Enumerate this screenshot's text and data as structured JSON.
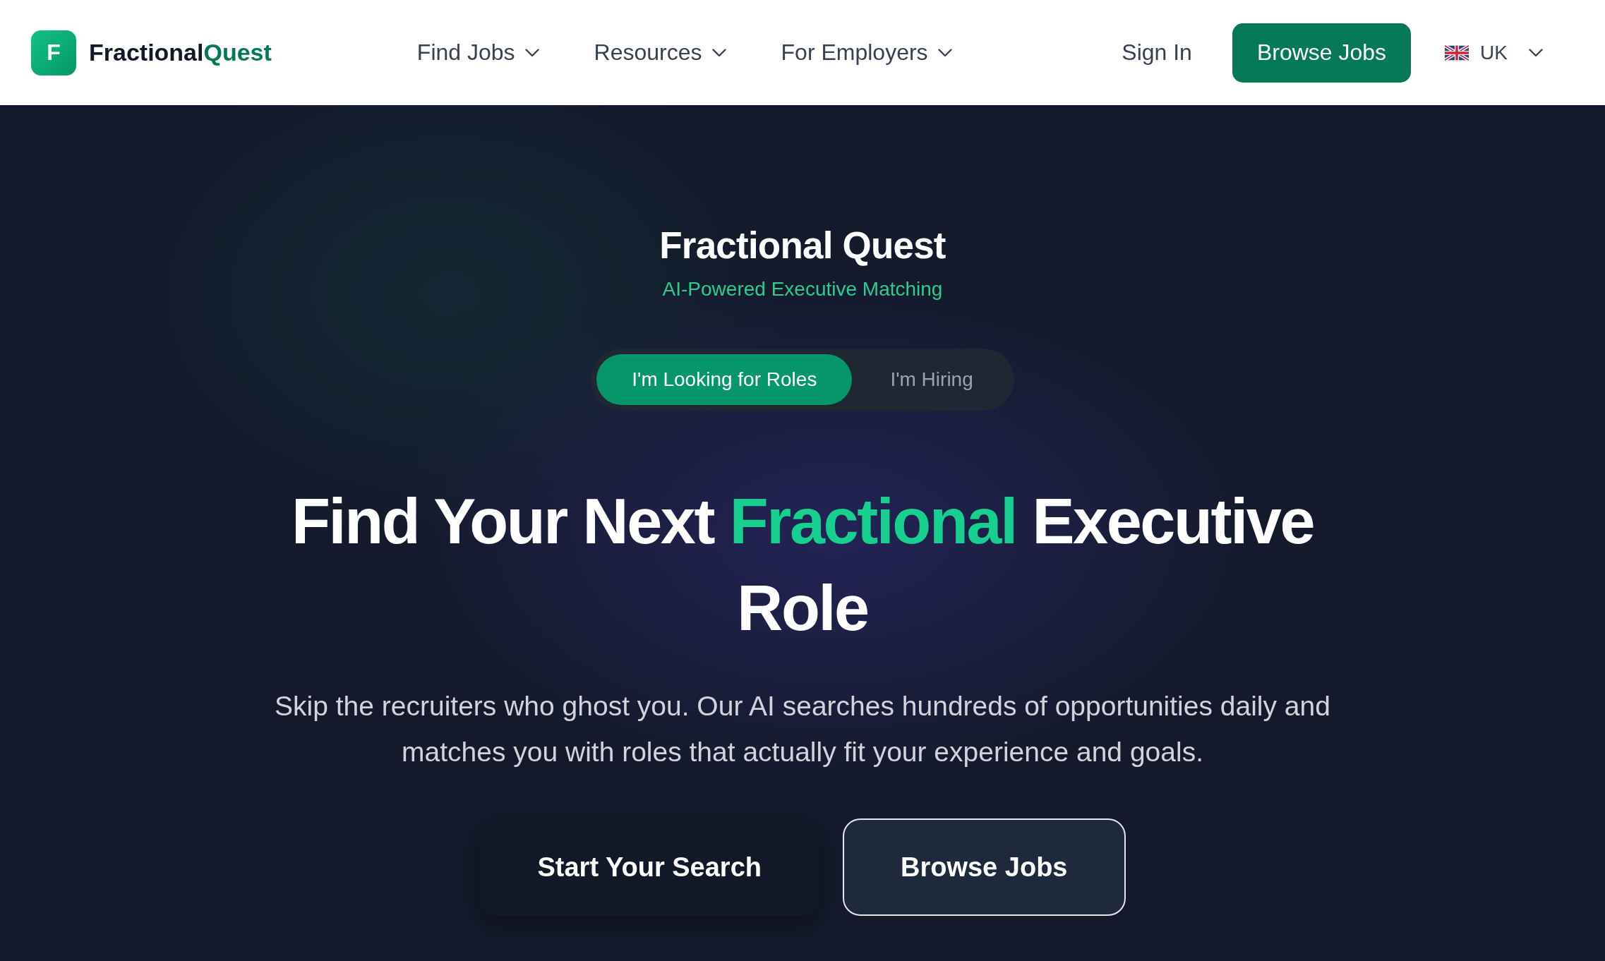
{
  "header": {
    "logo": {
      "letter": "F",
      "name": "Fractional",
      "accent": "Quest"
    },
    "nav": [
      {
        "label": "Find Jobs",
        "dropdown": true
      },
      {
        "label": "Resources",
        "dropdown": true
      },
      {
        "label": "For Employers",
        "dropdown": true
      }
    ],
    "sign_in": "Sign In",
    "cta": "Browse Jobs",
    "region": {
      "label": "UK",
      "dropdown": true
    }
  },
  "hero": {
    "title": "Fractional Quest",
    "tagline": "AI-Powered Executive Matching",
    "audience_toggle": [
      {
        "label": "I'm Looking for Roles",
        "selected": true
      },
      {
        "label": "I'm Hiring",
        "selected": false
      }
    ],
    "headline": [
      {
        "text": "Find Your Next",
        "highlight": false
      },
      {
        "text": "Fractional",
        "highlight": true
      },
      {
        "text": "Executive Role",
        "highlight": false
      }
    ],
    "description": "Skip the recruiters who ghost you. Our AI searches hundreds of opportunities daily and matches you with roles that actually fit your experience and goals.",
    "actions": [
      {
        "label": "Start Your Search",
        "kind": "solid"
      },
      {
        "label": "Browse Jobs",
        "kind": "outline"
      }
    ]
  }
}
